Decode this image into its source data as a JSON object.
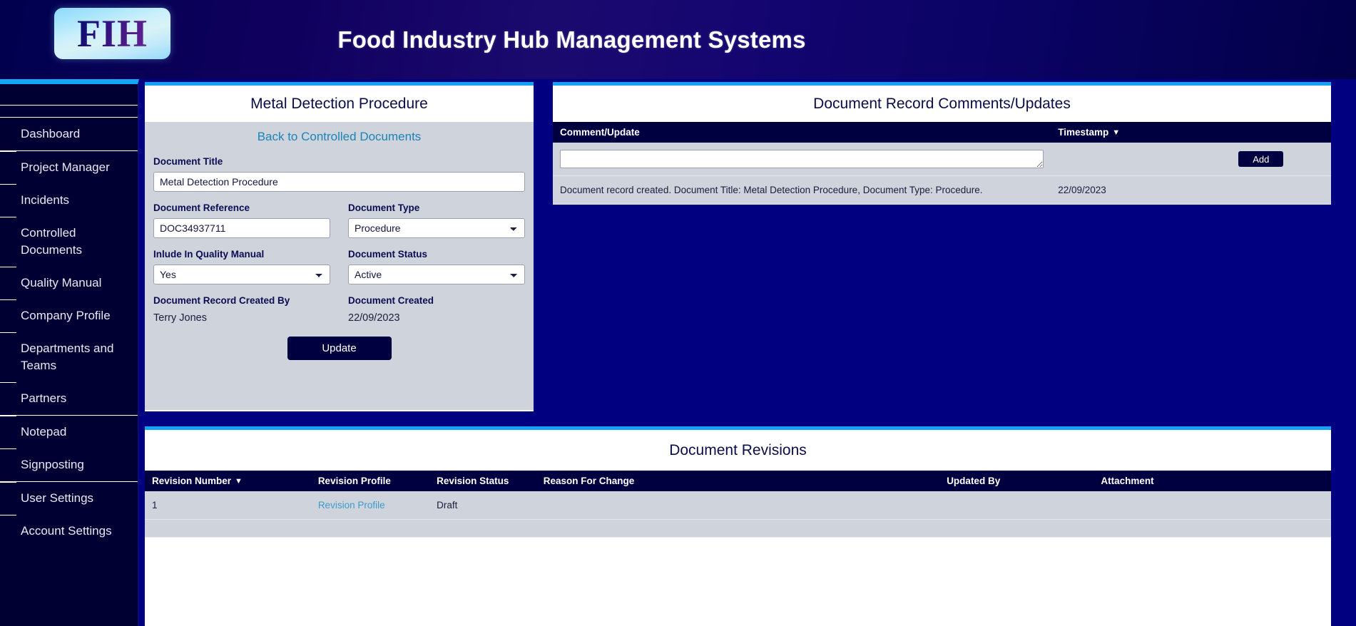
{
  "app": {
    "title": "Food Industry Hub Management Systems",
    "logo_text": "FIH",
    "accent_color": "#13a3f5",
    "header_bg": "#0d0a60",
    "page_bg": "#000080",
    "panel_body_bg": "#ced3dc",
    "dark_navy": "#000040"
  },
  "sidebar": {
    "groups": [
      {
        "items": [
          {
            "label": "Dashboard",
            "name": "dashboard"
          }
        ]
      },
      {
        "items": [
          {
            "label": "Project Manager",
            "name": "project-manager"
          },
          {
            "label": "Incidents",
            "name": "incidents"
          },
          {
            "label": "Controlled Documents",
            "name": "controlled-documents"
          },
          {
            "label": "Quality Manual",
            "name": "quality-manual"
          },
          {
            "label": "Company Profile",
            "name": "company-profile"
          },
          {
            "label": "Departments and Teams",
            "name": "departments-and-teams"
          },
          {
            "label": "Partners",
            "name": "partners"
          }
        ]
      },
      {
        "items": [
          {
            "label": "Notepad",
            "name": "notepad"
          },
          {
            "label": "Signposting",
            "name": "signposting"
          }
        ]
      },
      {
        "items": [
          {
            "label": "User Settings",
            "name": "user-settings"
          },
          {
            "label": "Account Settings",
            "name": "account-settings"
          }
        ]
      }
    ]
  },
  "document_panel": {
    "title": "Metal Detection Procedure",
    "back_link": "Back to Controlled Documents",
    "fields": {
      "document_title_label": "Document Title",
      "document_title_value": "Metal Detection Procedure",
      "document_reference_label": "Document Reference",
      "document_reference_value": "DOC34937711",
      "document_type_label": "Document Type",
      "document_type_value": "Procedure",
      "include_quality_manual_label": "Inlude In Quality Manual",
      "include_quality_manual_value": "Yes",
      "document_status_label": "Document Status",
      "document_status_value": "Active",
      "created_by_label": "Document Record Created By",
      "created_by_value": "Terry Jones",
      "document_created_label": "Document Created",
      "document_created_value": "22/09/2023"
    },
    "update_button": "Update"
  },
  "comments_panel": {
    "title": "Document Record Comments/Updates",
    "columns": [
      {
        "label": "Comment/Update",
        "sorted": false
      },
      {
        "label": "Timestamp",
        "sorted": true,
        "caret": "▼"
      }
    ],
    "new_comment_value": "",
    "new_comment_placeholder": "",
    "add_button": "Add",
    "rows": [
      {
        "comment": "Document record created. Document Title: Metal Detection Procedure, Document Type: Procedure.",
        "timestamp": "22/09/2023"
      }
    ]
  },
  "revisions_panel": {
    "title": "Document Revisions",
    "columns": [
      {
        "label": "Revision Number",
        "sorted": true,
        "caret": "▼"
      },
      {
        "label": "Revision Profile",
        "sorted": false
      },
      {
        "label": "Revision Status",
        "sorted": false
      },
      {
        "label": "Reason For Change",
        "sorted": false
      },
      {
        "label": "Updated By",
        "sorted": false
      },
      {
        "label": "Attachment",
        "sorted": false
      }
    ],
    "rows": [
      {
        "revision_number": "1",
        "revision_profile": "Revision Profile",
        "revision_status": "Draft",
        "reason_for_change": "",
        "updated_by": "",
        "attachment": ""
      }
    ]
  }
}
